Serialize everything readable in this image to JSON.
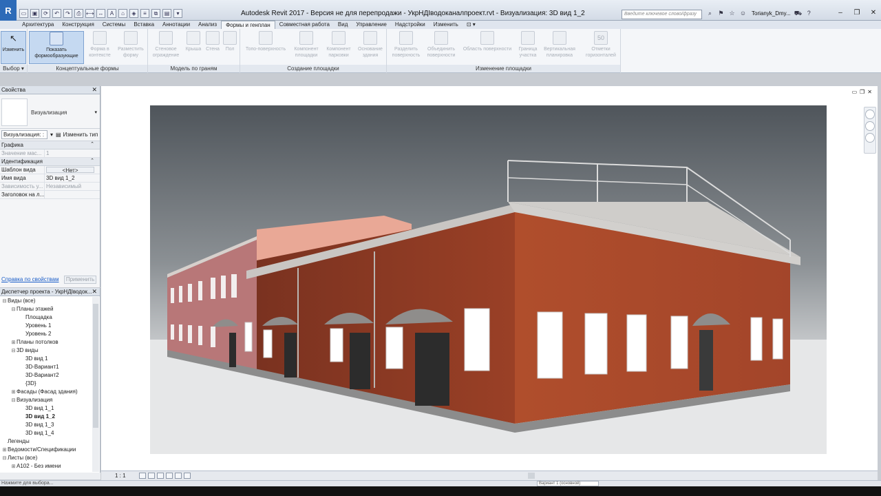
{
  "app": {
    "logo": "R",
    "title": "Autodesk Revit 2017 - Версия не для перепродажи -    УкрНДІводоканалпроект.rvt - Визуализация: 3D вид 1_2",
    "search_placeholder": "Введите ключевое слово/фразу",
    "user": "Torianyk_Dmy..."
  },
  "tabs": [
    {
      "label": "Архитектура"
    },
    {
      "label": "Конструкция"
    },
    {
      "label": "Системы"
    },
    {
      "label": "Вставка"
    },
    {
      "label": "Аннотации"
    },
    {
      "label": "Анализ"
    },
    {
      "label": "Формы и генплан"
    },
    {
      "label": "Совместная работа"
    },
    {
      "label": "Вид"
    },
    {
      "label": "Управление"
    },
    {
      "label": "Надстройки"
    },
    {
      "label": "Изменить"
    }
  ],
  "ribbon": {
    "select": {
      "modify": "Изменить",
      "label": "Выбор ▾"
    },
    "conceptual": {
      "show_mass": "Показать формообразующие",
      "in_context": "Форма в контексте",
      "place_mass": "Разместить форму",
      "label": "Концептуальные формы"
    },
    "by_face": {
      "curtain": "Стеновое ограждение",
      "roof": "Крыша",
      "wall": "Стена",
      "floor": "Пол",
      "label": "Модель по граням"
    },
    "site_create": {
      "toposurface": "Топо-поверхность",
      "site_component": "Компонент площадки",
      "parking": "Компонент парковки",
      "pad": "Основание здания",
      "label": "Создание площадки"
    },
    "site_modify": {
      "split": "Разделить поверхность",
      "merge": "Объединить поверхности",
      "subregion": "Область поверхности",
      "property_line": "Граница участка",
      "graded": "Вертикальная планировка",
      "label": "Изменение площадки"
    },
    "spot": {
      "label_mark": "50",
      "elevation": "Отметки горизонталей"
    }
  },
  "properties": {
    "header": "Свойства",
    "type_name": "Визуализация",
    "instance_selector": "Визуализация: :",
    "edit_type": "Изменить тип",
    "groups": [
      {
        "name": "Графика",
        "rows": [
          {
            "name": "Значение мас...",
            "value": "1",
            "dim": true
          }
        ]
      },
      {
        "name": "Идентификация",
        "rows": [
          {
            "name": "Шаблон вида",
            "value": "<Нет>",
            "button": true
          },
          {
            "name": "Имя вида",
            "value": "3D вид 1_2"
          },
          {
            "name": "Зависимость у...",
            "value": "Независимый",
            "dim": true
          },
          {
            "name": "Заголовок на л...",
            "value": ""
          }
        ]
      }
    ],
    "help_link": "Справка по свойствам",
    "apply": "Применить"
  },
  "browser": {
    "header": "Диспетчер проекта - УкрНДІводок...",
    "items": [
      {
        "label": "Виды (все)",
        "level": 0,
        "toggle": "⊟"
      },
      {
        "label": "Планы этажей",
        "level": 1,
        "toggle": "⊟"
      },
      {
        "label": "Площадка",
        "level": 2,
        "toggle": ""
      },
      {
        "label": "Уровень 1",
        "level": 2,
        "toggle": ""
      },
      {
        "label": "Уровень 2",
        "level": 2,
        "toggle": ""
      },
      {
        "label": "Планы потолков",
        "level": 1,
        "toggle": "⊞"
      },
      {
        "label": "3D виды",
        "level": 1,
        "toggle": "⊟"
      },
      {
        "label": "3D вид 1",
        "level": 2,
        "toggle": ""
      },
      {
        "label": "3D-Вариант1",
        "level": 2,
        "toggle": ""
      },
      {
        "label": "3D-Вариант2",
        "level": 2,
        "toggle": ""
      },
      {
        "label": "{3D}",
        "level": 2,
        "toggle": ""
      },
      {
        "label": "Фасады (Фасад здания)",
        "level": 1,
        "toggle": "⊞"
      },
      {
        "label": "Визуализация",
        "level": 1,
        "toggle": "⊟"
      },
      {
        "label": "3D вид 1_1",
        "level": 2,
        "toggle": ""
      },
      {
        "label": "3D вид 1_2",
        "level": 2,
        "toggle": "",
        "selected": true
      },
      {
        "label": "3D вид 1_3",
        "level": 2,
        "toggle": ""
      },
      {
        "label": "3D вид 1_4",
        "level": 2,
        "toggle": ""
      },
      {
        "label": "Легенды",
        "level": 0,
        "toggle": ""
      },
      {
        "label": "Ведомости/Спецификации",
        "level": 0,
        "toggle": "⊞"
      },
      {
        "label": "Листы (все)",
        "level": 0,
        "toggle": "⊟"
      },
      {
        "label": "A102 - Без имени",
        "level": 1,
        "toggle": "⊞"
      }
    ]
  },
  "viewbar": {
    "scale": "1 : 1"
  },
  "status": {
    "text": "Нажмите для выбора...",
    "workset": "Вариант 1 (основной)"
  },
  "colors": {
    "accent": "#2d6bb8",
    "facade_brick": "#a4472a",
    "facade_pink": "#b87778"
  }
}
